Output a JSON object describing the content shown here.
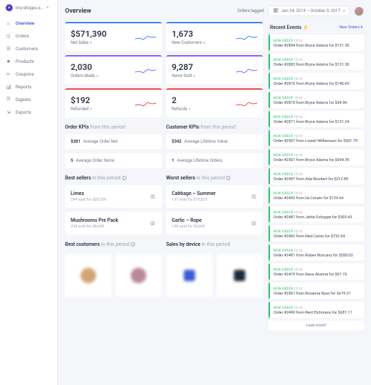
{
  "brand": {
    "name": "tiny.shoppu.s...",
    "chev": "▾"
  },
  "nav": [
    {
      "icon": "⌂",
      "label": "Overview",
      "active": true
    },
    {
      "icon": "🛒",
      "label": "Orders"
    },
    {
      "icon": "☰",
      "label": "Customers"
    },
    {
      "icon": "❖",
      "label": "Products"
    },
    {
      "icon": "✂",
      "label": "Coupons"
    },
    {
      "icon": "📊",
      "label": "Reports"
    },
    {
      "icon": "🗎",
      "label": "Digests"
    },
    {
      "icon": "⇲",
      "label": "Exports"
    }
  ],
  "header": {
    "title": "Overview",
    "orders_tagged": "Orders tagged",
    "cal_icon": "🗓",
    "date_range": "Jan 24, 2014 – October 9, 2017",
    "chev": "▾"
  },
  "kpis": [
    {
      "val": "$571,390",
      "label": "Net Sales",
      "cls": "blue",
      "spark": "blue"
    },
    {
      "val": "1,673",
      "label": "New Customers",
      "cls": "blue",
      "spark": "blue"
    },
    {
      "val": "2,030",
      "label": "Orders Made",
      "cls": "purple",
      "spark": "purple"
    },
    {
      "val": "9,287",
      "label": "Items Sold",
      "cls": "purple",
      "spark": "purple"
    },
    {
      "val": "$192",
      "label": "Refunded",
      "cls": "red",
      "spark": "red"
    },
    {
      "val": "2",
      "label": "Refunds",
      "cls": "red",
      "spark": "red"
    }
  ],
  "order_kpis": {
    "title": "Order KPIs",
    "sub": "from this period",
    "rows": [
      {
        "val": "$281",
        "label": "Average Order Net"
      },
      {
        "val": "5",
        "label": "Average Order Items"
      }
    ]
  },
  "customer_kpis": {
    "title": "Customer KPIs",
    "sub": "from this period",
    "rows": [
      {
        "val": "$342",
        "label": "Average Lifetime Value"
      },
      {
        "val": "1",
        "label": "Average Lifetime Orders"
      }
    ]
  },
  "best_sellers": {
    "title": "Best sellers",
    "sub": "in this period",
    "items": [
      {
        "name": "Limes",
        "sub": "294 sold for $28,329"
      },
      {
        "name": "Mushrooms Pre Pack",
        "sub": "234 sold for $4,640"
      }
    ]
  },
  "worst_sellers": {
    "title": "Worst sellers",
    "sub": "in this period",
    "items": [
      {
        "name": "Cabbage – Summer",
        "sub": "137 sold for $10,833"
      },
      {
        "name": "Garlic – Rope",
        "sub": "158 sold for $4,842"
      }
    ]
  },
  "best_customers": {
    "title": "Best customers",
    "sub": "in this period"
  },
  "sales_device": {
    "title": "Sales by device",
    "sub": "in this period"
  },
  "events_panel": {
    "title": "Recent Events",
    "bolt": "⚡",
    "link": "New Orders ▾",
    "load_more": "Load more?",
    "items": [
      {
        "tag": "NEW ORDER",
        "time": "10:14",
        "text": "Order #2894 from Bryce Adams for $131.30"
      },
      {
        "tag": "NEW ORDER",
        "time": "10:14",
        "text": "Order #2883 from Bryce Adams for $131.30"
      },
      {
        "tag": "NEW ORDER",
        "time": "10:14",
        "text": "Order #2876 from Bryce Adams for $140.69"
      },
      {
        "tag": "NEW ORDER",
        "time": "10:14",
        "text": "Order #2875 from Bryce Adams for $54.96"
      },
      {
        "tag": "NEW ORDER",
        "time": "10:14",
        "text": "Order #2871 from Bryce Adams for $131.24"
      },
      {
        "tag": "NEW ORDER",
        "time": "10:14",
        "text": "Order #2507 from Lowell Williamson for $501.79"
      },
      {
        "tag": "NEW ORDER",
        "time": "10:14",
        "text": "Order #2501 from Bryce Adams for $694.39"
      },
      {
        "tag": "NEW ORDER",
        "time": "10:14",
        "text": "Order #2497 from Ada Wuckert for $212.89"
      },
      {
        "tag": "NEW ORDER",
        "time": "10:14",
        "text": "Order #2492 from Ila Corwin for $129.64"
      },
      {
        "tag": "NEW ORDER",
        "time": "10:14",
        "text": "Order #2487 from Jettie Schuppe for $305.43"
      },
      {
        "tag": "NEW ORDER",
        "time": "10:14",
        "text": "Order #2482 from Ned Carter for $732.54"
      },
      {
        "tag": "NEW ORDER",
        "time": "10:14",
        "text": "Order #2481 from Ruben Boncany for $558.02"
      },
      {
        "tag": "NEW ORDER",
        "time": "10:14",
        "text": "Order #2479 from Rena Abshire for $97.70"
      },
      {
        "tag": "NEW ORDER",
        "time": "10:14",
        "text": "Order #2501 from Rosanna Ryan for $619.31"
      },
      {
        "tag": "NEW ORDER",
        "time": "10:14",
        "text": "Order #2490 from Rent Eichmann for $681.11"
      }
    ]
  }
}
